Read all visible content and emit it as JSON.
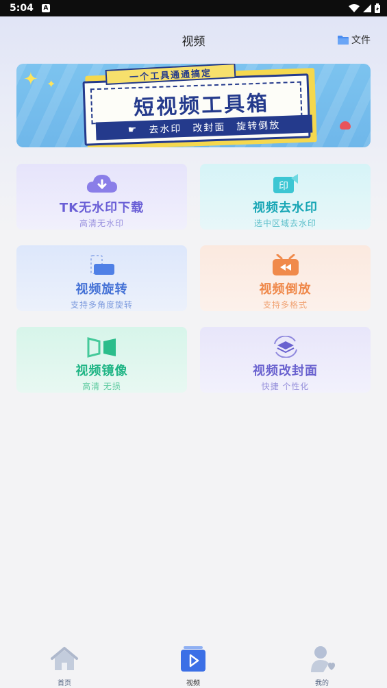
{
  "status_bar": {
    "time": "5:04"
  },
  "header": {
    "title": "视频",
    "files_label": "文件"
  },
  "banner": {
    "tag": "一个工具通通搞定",
    "title": "短视频工具箱",
    "features": [
      "去水印",
      "改封面",
      "旋转倒放"
    ]
  },
  "tools": [
    {
      "title": "TK无水印下载",
      "subtitle": "高清无水印"
    },
    {
      "title": "视频去水印",
      "subtitle": "选中区域去水印"
    },
    {
      "title": "视频旋转",
      "subtitle": "支持多角度旋转"
    },
    {
      "title": "视频倒放",
      "subtitle": "支持多格式"
    },
    {
      "title": "视频镜像",
      "subtitle": "高清 无损"
    },
    {
      "title": "视频改封面",
      "subtitle": "快捷 个性化"
    }
  ],
  "tabs": [
    {
      "label": "首页"
    },
    {
      "label": "视频"
    },
    {
      "label": "我的"
    }
  ],
  "colors": {
    "active_tab": "#3b6fe6",
    "inactive_tab": "#b5c0d6"
  }
}
